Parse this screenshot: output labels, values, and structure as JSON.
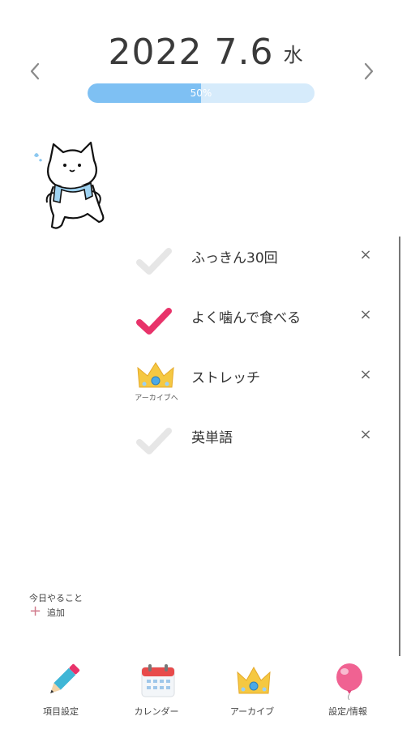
{
  "header": {
    "date": "2022 7.6",
    "weekday": "水",
    "prev_icon": "chevron-left-icon",
    "next_icon": "chevron-right-icon"
  },
  "progress": {
    "label": "50%",
    "value": 0.5,
    "fill_color": "#7ec0f3",
    "track_color": "#d6ebfb"
  },
  "tasks": [
    {
      "label": "ふっきん30回",
      "state": "unchecked"
    },
    {
      "label": "よく噛んで食べる",
      "state": "checked"
    },
    {
      "label": "ストレッチ",
      "state": "archive",
      "caption": "アーカイブへ"
    },
    {
      "label": "英単語",
      "state": "unchecked"
    }
  ],
  "delete_glyph": "×",
  "today": {
    "label": "今日やること",
    "add_label": "追加",
    "add_glyph": "+"
  },
  "bottom_nav": [
    {
      "label": "項目設定",
      "icon": "pencil-icon"
    },
    {
      "label": "カレンダー",
      "icon": "calendar-icon"
    },
    {
      "label": "アーカイブ",
      "icon": "crown-icon"
    },
    {
      "label": "設定/情報",
      "icon": "balloon-icon"
    }
  ],
  "colors": {
    "check_active": "#e8336a",
    "check_inactive": "#e6e6e6",
    "crown": "#f5c842"
  }
}
